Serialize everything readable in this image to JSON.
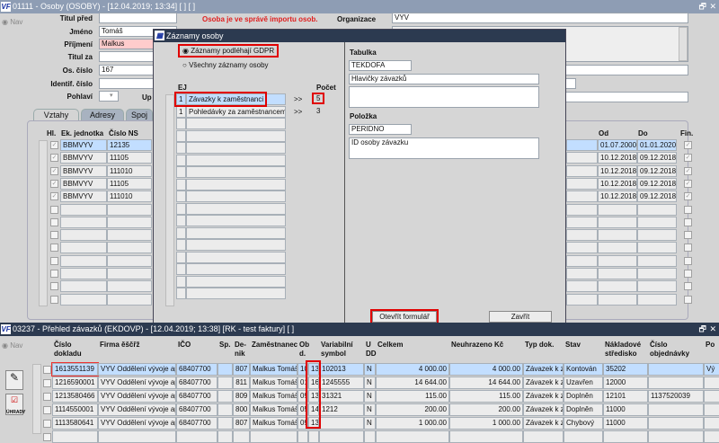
{
  "top_window": {
    "title": "01111 - Osoby (OSOBY) - [12.04.2019; 13:34]  [ ]  [ ]",
    "nav": "Nav",
    "message": "Osoba je ve správě importu osob.",
    "fields": [
      {
        "label": "Titul před",
        "value": ""
      },
      {
        "label": "Jméno",
        "value": "Tomáš"
      },
      {
        "label": "Příjmení",
        "value": "Malkus"
      },
      {
        "label": "Titul za",
        "value": ""
      },
      {
        "label": "Os. číslo",
        "value": "167"
      },
      {
        "label": "Identif. číslo",
        "value": ""
      },
      {
        "label": "Pohlaví",
        "value": ""
      }
    ],
    "up_label": "Up",
    "organizace_label": "Organizace",
    "organizace_value": "VYV",
    "tabs": [
      "Vztahy",
      "Adresy",
      "Spoj"
    ],
    "grid_headers": {
      "hl": "Hl.",
      "ek": "Ek. jednotka",
      "ns": "Číslo NS",
      "od": "Od",
      "do": "Do",
      "fin": "Fin."
    },
    "grid_rows": [
      {
        "ek": "BBMVYV",
        "ns": "12135",
        "od": "01.07.2000",
        "do": "01.01.2020"
      },
      {
        "ek": "BBMVYV",
        "ns": "11105",
        "od": "10.12.2018",
        "do": "09.12.2018"
      },
      {
        "ek": "BBMVYV",
        "ns": "111010",
        "od": "10.12.2018",
        "do": "09.12.2018"
      },
      {
        "ek": "BBMVYV",
        "ns": "11105",
        "od": "10.12.2018",
        "do": "09.12.2018"
      },
      {
        "ek": "BBMVYV",
        "ns": "111010",
        "od": "10.12.2018",
        "do": "09.12.2018"
      }
    ]
  },
  "dialog": {
    "title": "Záznamy osoby",
    "radio_gdpr": "Záznamy podléhají GDPR",
    "radio_all": "Všechny záznamy osoby",
    "ej_header": "EJ",
    "pocet_header": "Počet",
    "rows": [
      {
        "ej": "1",
        "name": "Závazky k zaměstnanci",
        "arrow": ">>",
        "count": "5"
      },
      {
        "ej": "1",
        "name": "Pohledávky za zaměstnancem",
        "arrow": ">>",
        "count": "3"
      }
    ],
    "tabulka_label": "Tabulka",
    "tabulka_code": "TEKDOFA",
    "tabulka_name": "Hlavičky závazků",
    "polozka_label": "Položka",
    "polozka_code": "PERIDNO",
    "polozka_name": "ID osoby závazku",
    "open_button": "Otevřít formulář",
    "close_button": "Zavřít"
  },
  "bottom_window": {
    "title": "03237 - Přehled závazků (EKDOVP) - [12.04.2019; 13:38]  [RK - test faktury]  [ ]",
    "nav": "Nav",
    "side_icon_label": "ÚHRADY",
    "headers": [
      "Číslo dokladu",
      "Firma ěščřž",
      "IČO",
      "Sp.",
      "De-nik",
      "Zaměstnanec",
      "Ob d.",
      "",
      "Variabilní symbol",
      "U DD",
      "Celkem",
      "Neuhrazeno Kč",
      "Typ dok.",
      "Stav",
      "Nákladové středisko",
      "Číslo objednávky",
      "Po"
    ],
    "rows": [
      [
        "1613551139",
        "VYV Oddělení vývoje apl",
        "68407700",
        "",
        "807",
        "Malkus Tomáš",
        "10",
        "13",
        "102013",
        "N",
        "4 000.00",
        "4 000.00",
        "Závazek k z",
        "Kontován",
        "35202",
        "",
        "Vý"
      ],
      [
        "1216590001",
        "VYV Oddělení vývoje apl",
        "68407700",
        "",
        "811",
        "Malkus Tomáš",
        "01",
        "16",
        "1245555",
        "N",
        "14 644.00",
        "14 644.00",
        "Závazek k z",
        "Uzavřen",
        "12000",
        "",
        ""
      ],
      [
        "1213580466",
        "VYV Oddělení vývoje apl",
        "68407700",
        "",
        "809",
        "Malkus Tomáš",
        "09",
        "13",
        "31321",
        "N",
        "115.00",
        "115.00",
        "Závazek k z",
        "Doplněn",
        "12101",
        "1137520039",
        ""
      ],
      [
        "1114550001",
        "VYV Oddělení vývoje apl",
        "68407700",
        "",
        "800",
        "Malkus Tomáš",
        "05",
        "14",
        "1212",
        "N",
        "200.00",
        "200.00",
        "Závazek k z",
        "Doplněn",
        "11000",
        "",
        ""
      ],
      [
        "1113580641",
        "VYV Oddělení vývoje apl",
        "68407700",
        "",
        "807",
        "Malkus Tomáš",
        "09",
        "13",
        "",
        "N",
        "1 000.00",
        "1 000.00",
        "Závazek k z",
        "Chybový",
        "11000",
        "",
        ""
      ]
    ]
  }
}
